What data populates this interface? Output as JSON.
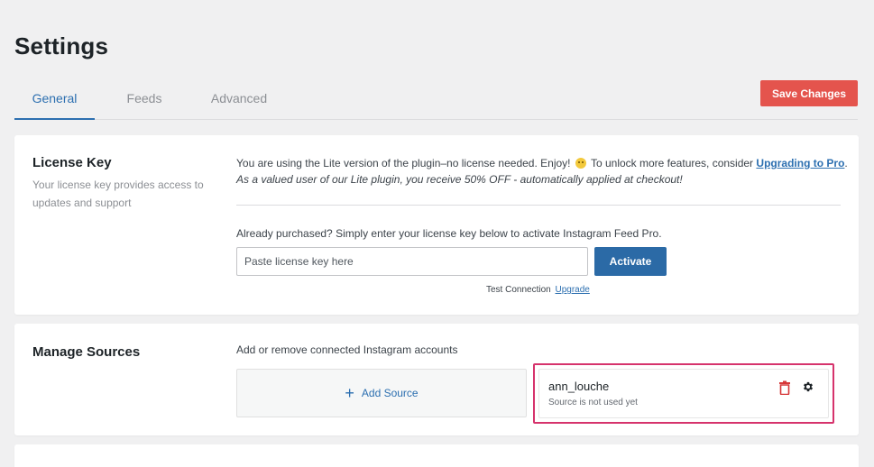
{
  "page": {
    "title": "Settings"
  },
  "tabs": [
    {
      "label": "General"
    },
    {
      "label": "Feeds"
    },
    {
      "label": "Advanced"
    }
  ],
  "header": {
    "save_label": "Save Changes"
  },
  "license": {
    "heading": "License Key",
    "subtitle": "Your license key provides access to updates and support",
    "lite_notice_prefix": "You are using the Lite version of the plugin–no license needed. Enjoy!",
    "lite_notice_middle": "To unlock more features, consider",
    "upgrade_link": "Upgrading to Pro",
    "lite_notice_suffix": ".",
    "discount_note": "As a valued user of our Lite plugin, you receive 50% OFF - automatically applied at checkout!",
    "already_purchased": "Already purchased? Simply enter your license key below to activate Instagram Feed Pro.",
    "input_placeholder": "Paste license key here",
    "activate_label": "Activate",
    "test_connection": "Test Connection",
    "upgrade_small": "Upgrade"
  },
  "sources": {
    "heading": "Manage Sources",
    "description": "Add or remove connected Instagram accounts",
    "add_label": "Add Source",
    "items": [
      {
        "name": "ann_louche",
        "status": "Source is not used yet"
      }
    ]
  },
  "colors": {
    "accent": "#2c6fb0",
    "save": "#e4544d",
    "activate": "#2b6aa6",
    "highlight": "#d6336c",
    "trash": "#d63638"
  },
  "icons": {
    "add": "plus-icon",
    "delete": "trash-icon",
    "settings": "gear-icon",
    "emoji": "smiley-icon"
  }
}
